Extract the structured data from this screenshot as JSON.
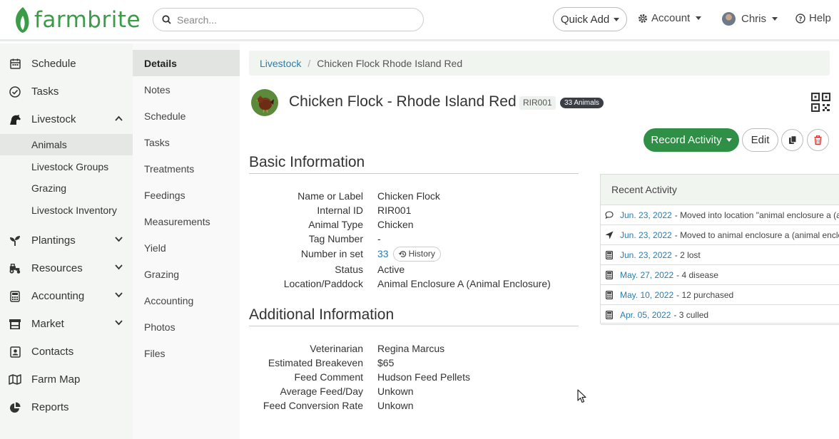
{
  "brand": {
    "name": "farmbrite",
    "color": "#3b9b47"
  },
  "header": {
    "search_placeholder": "Search...",
    "quick_add": "Quick Add",
    "account": "Account",
    "user": "Chris",
    "help": "Help"
  },
  "nav": {
    "items": [
      {
        "label": "Schedule",
        "icon": "calendar-icon"
      },
      {
        "label": "Tasks",
        "icon": "check-circle-icon"
      },
      {
        "label": "Livestock",
        "icon": "horse-icon"
      },
      {
        "label": "Plantings",
        "icon": "sprout-icon"
      },
      {
        "label": "Resources",
        "icon": "tractor-icon"
      },
      {
        "label": "Accounting",
        "icon": "calculator-icon"
      },
      {
        "label": "Market",
        "icon": "store-icon"
      },
      {
        "label": "Contacts",
        "icon": "contact-card-icon"
      },
      {
        "label": "Farm Map",
        "icon": "map-icon"
      },
      {
        "label": "Reports",
        "icon": "pie-chart-icon"
      }
    ],
    "livestock_sub": [
      "Animals",
      "Livestock Groups",
      "Grazing",
      "Livestock Inventory"
    ]
  },
  "section_menu": [
    "Details",
    "Notes",
    "Schedule",
    "Tasks",
    "Treatments",
    "Feedings",
    "Measurements",
    "Yield",
    "Grazing",
    "Accounting",
    "Photos",
    "Files"
  ],
  "breadcrumb": {
    "parent": "Livestock",
    "current": "Chicken Flock Rhode Island Red"
  },
  "animal": {
    "title": "Chicken Flock - Rhode Island Red",
    "tag": "RIR001",
    "count_badge": "33 Animals"
  },
  "actions": {
    "record": "Record Activity",
    "edit": "Edit"
  },
  "basic": {
    "title": "Basic Information",
    "fields": [
      {
        "k": "Name or Label",
        "v": "Chicken Flock",
        "link": false
      },
      {
        "k": "Internal ID",
        "v": "RIR001",
        "link": false
      },
      {
        "k": "Animal Type",
        "v": "Chicken",
        "link": true
      },
      {
        "k": "Tag Number",
        "v": "-",
        "link": false
      },
      {
        "k": "Number in set",
        "v": "33",
        "link": true
      },
      {
        "k": "Status",
        "v": "Active",
        "link": true
      },
      {
        "k": "Location/Paddock",
        "v": "Animal Enclosure A (Animal Enclosure)",
        "link": true
      }
    ],
    "history_label": "History"
  },
  "additional": {
    "title": "Additional Information",
    "fields": [
      {
        "k": "Veterinarian",
        "v": "Regina Marcus",
        "link": true
      },
      {
        "k": "Estimated Breakeven",
        "v": "$65",
        "link": false
      },
      {
        "k": "Feed Comment",
        "v": "Hudson Feed Pellets",
        "link": false
      },
      {
        "k": "Average Feed/Day",
        "v": "Unkown",
        "link": true
      },
      {
        "k": "Feed Conversion Rate",
        "v": "Unkown",
        "link": true
      }
    ]
  },
  "recent": {
    "title": "Recent Activity",
    "rows": [
      {
        "icon": "comment-icon",
        "date": "Jun. 23, 2022",
        "text": "- Moved into location \"animal enclosure a (animal enclosure)\""
      },
      {
        "icon": "location-arrow-icon",
        "date": "Jun. 23, 2022",
        "text": "- Moved to animal enclosure a (animal enclosure)"
      },
      {
        "icon": "calculator-icon",
        "date": "Jun. 23, 2022",
        "text": "- 2 lost"
      },
      {
        "icon": "calculator-icon",
        "date": "May. 27, 2022",
        "text": "- 4 disease"
      },
      {
        "icon": "calculator-icon",
        "date": "May. 10, 2022",
        "text": "- 12 purchased"
      },
      {
        "icon": "calculator-icon",
        "date": "Apr. 05, 2022",
        "text": "- 3 culled"
      }
    ]
  }
}
